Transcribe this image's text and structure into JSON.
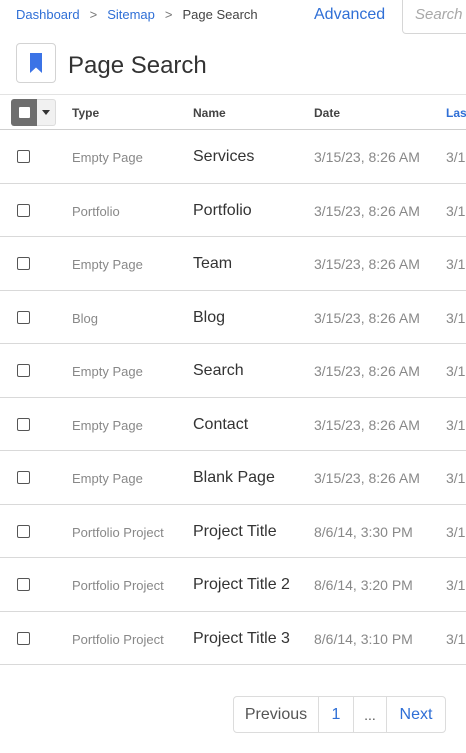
{
  "breadcrumb": {
    "items": [
      {
        "label": "Dashboard"
      },
      {
        "label": "Sitemap"
      }
    ],
    "separator": ">",
    "current": "Page Search"
  },
  "header": {
    "advanced_label": "Advanced",
    "search_placeholder": "Search",
    "search_value": "",
    "page_title": "Page Search",
    "icon": "bookmark-icon"
  },
  "table": {
    "columns": [
      "Type",
      "Name",
      "Date",
      "Last"
    ],
    "rows": [
      {
        "type": "Empty Page",
        "name": "Services",
        "date": "3/15/23, 8:26 AM",
        "last": "3/1"
      },
      {
        "type": "Portfolio",
        "name": "Portfolio",
        "date": "3/15/23, 8:26 AM",
        "last": "3/1"
      },
      {
        "type": "Empty Page",
        "name": "Team",
        "date": "3/15/23, 8:26 AM",
        "last": "3/1"
      },
      {
        "type": "Blog",
        "name": "Blog",
        "date": "3/15/23, 8:26 AM",
        "last": "3/1"
      },
      {
        "type": "Empty Page",
        "name": "Search",
        "date": "3/15/23, 8:26 AM",
        "last": "3/1"
      },
      {
        "type": "Empty Page",
        "name": "Contact",
        "date": "3/15/23, 8:26 AM",
        "last": "3/1"
      },
      {
        "type": "Empty Page",
        "name": "Blank Page",
        "date": "3/15/23, 8:26 AM",
        "last": "3/1"
      },
      {
        "type": "Portfolio Project",
        "name": "Project Title",
        "date": "8/6/14, 3:30 PM",
        "last": "3/1"
      },
      {
        "type": "Portfolio Project",
        "name": "Project Title 2",
        "date": "8/6/14, 3:20 PM",
        "last": "3/1"
      },
      {
        "type": "Portfolio Project",
        "name": "Project Title 3",
        "date": "8/6/14, 3:10 PM",
        "last": "3/1"
      }
    ]
  },
  "pagination": {
    "previous_label": "Previous",
    "current_page": "1",
    "ellipsis": "...",
    "next_label": "Next"
  },
  "colors": {
    "link": "#2f6fd6",
    "bookmark": "#3b73e6",
    "select_all_bg": "#6e6e6e"
  }
}
